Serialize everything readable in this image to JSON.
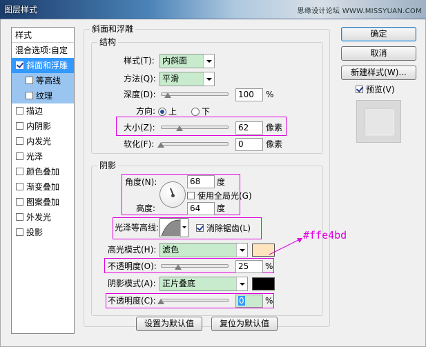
{
  "window": {
    "title": "图层样式",
    "watermark": "思缘设计论坛 WWW.MISSYUAN.COM"
  },
  "style_list": {
    "header": "样式",
    "blend_options": "混合选项:自定",
    "items": [
      {
        "label": "斜面和浮雕",
        "checked": true
      },
      {
        "label": "等高线",
        "checked": false
      },
      {
        "label": "纹理",
        "checked": false
      },
      {
        "label": "描边",
        "checked": false
      },
      {
        "label": "内阴影",
        "checked": false
      },
      {
        "label": "内发光",
        "checked": false
      },
      {
        "label": "光泽",
        "checked": false
      },
      {
        "label": "颜色叠加",
        "checked": false
      },
      {
        "label": "渐变叠加",
        "checked": false
      },
      {
        "label": "图案叠加",
        "checked": false
      },
      {
        "label": "外发光",
        "checked": false
      },
      {
        "label": "投影",
        "checked": false
      }
    ]
  },
  "buttons": {
    "ok": "确定",
    "cancel": "取消",
    "new_style": "新建样式(W)...",
    "preview": "预览(V)",
    "set_default": "设置为默认值",
    "reset_default": "复位为默认值"
  },
  "bevel": {
    "group_title": "斜面和浮雕",
    "structure": {
      "title": "结构",
      "style_label": "样式(T):",
      "style_value": "内斜面",
      "technique_label": "方法(Q):",
      "technique_value": "平滑",
      "depth_label": "深度(D):",
      "depth_value": "100",
      "depth_unit": "%",
      "depth_fraction": 0.1,
      "direction_label": "方向:",
      "dir_up": "上",
      "dir_down": "下",
      "size_label": "大小(Z):",
      "size_value": "62",
      "size_unit": "像素",
      "size_fraction": 0.28,
      "soften_label": "软化(F):",
      "soften_value": "0",
      "soften_unit": "像素",
      "soften_fraction": 0.0
    },
    "shading": {
      "title": "阴影",
      "angle_label": "角度(N):",
      "angle_value": "68",
      "angle_unit": "度",
      "global_light": "使用全局光(G)",
      "altitude_label": "高度:",
      "altitude_value": "64",
      "altitude_unit": "度",
      "gloss_label": "光泽等高线:",
      "anti_alias": "消除锯齿(L)",
      "highlight_mode_label": "高光模式(H):",
      "highlight_mode_value": "滤色",
      "highlight_color": "#ffe4bd",
      "highlight_opacity_label": "不透明度(O):",
      "highlight_opacity_value": "25",
      "highlight_opacity_unit": "%",
      "highlight_opacity_fraction": 0.25,
      "shadow_mode_label": "阴影模式(A):",
      "shadow_mode_value": "正片叠底",
      "shadow_color": "#000000",
      "shadow_opacity_label": "不透明度(C):",
      "shadow_opacity_value": "0",
      "shadow_opacity_unit": "%",
      "shadow_opacity_fraction": 0.0
    }
  },
  "annotation": {
    "color_code": "#ffe4bd"
  }
}
